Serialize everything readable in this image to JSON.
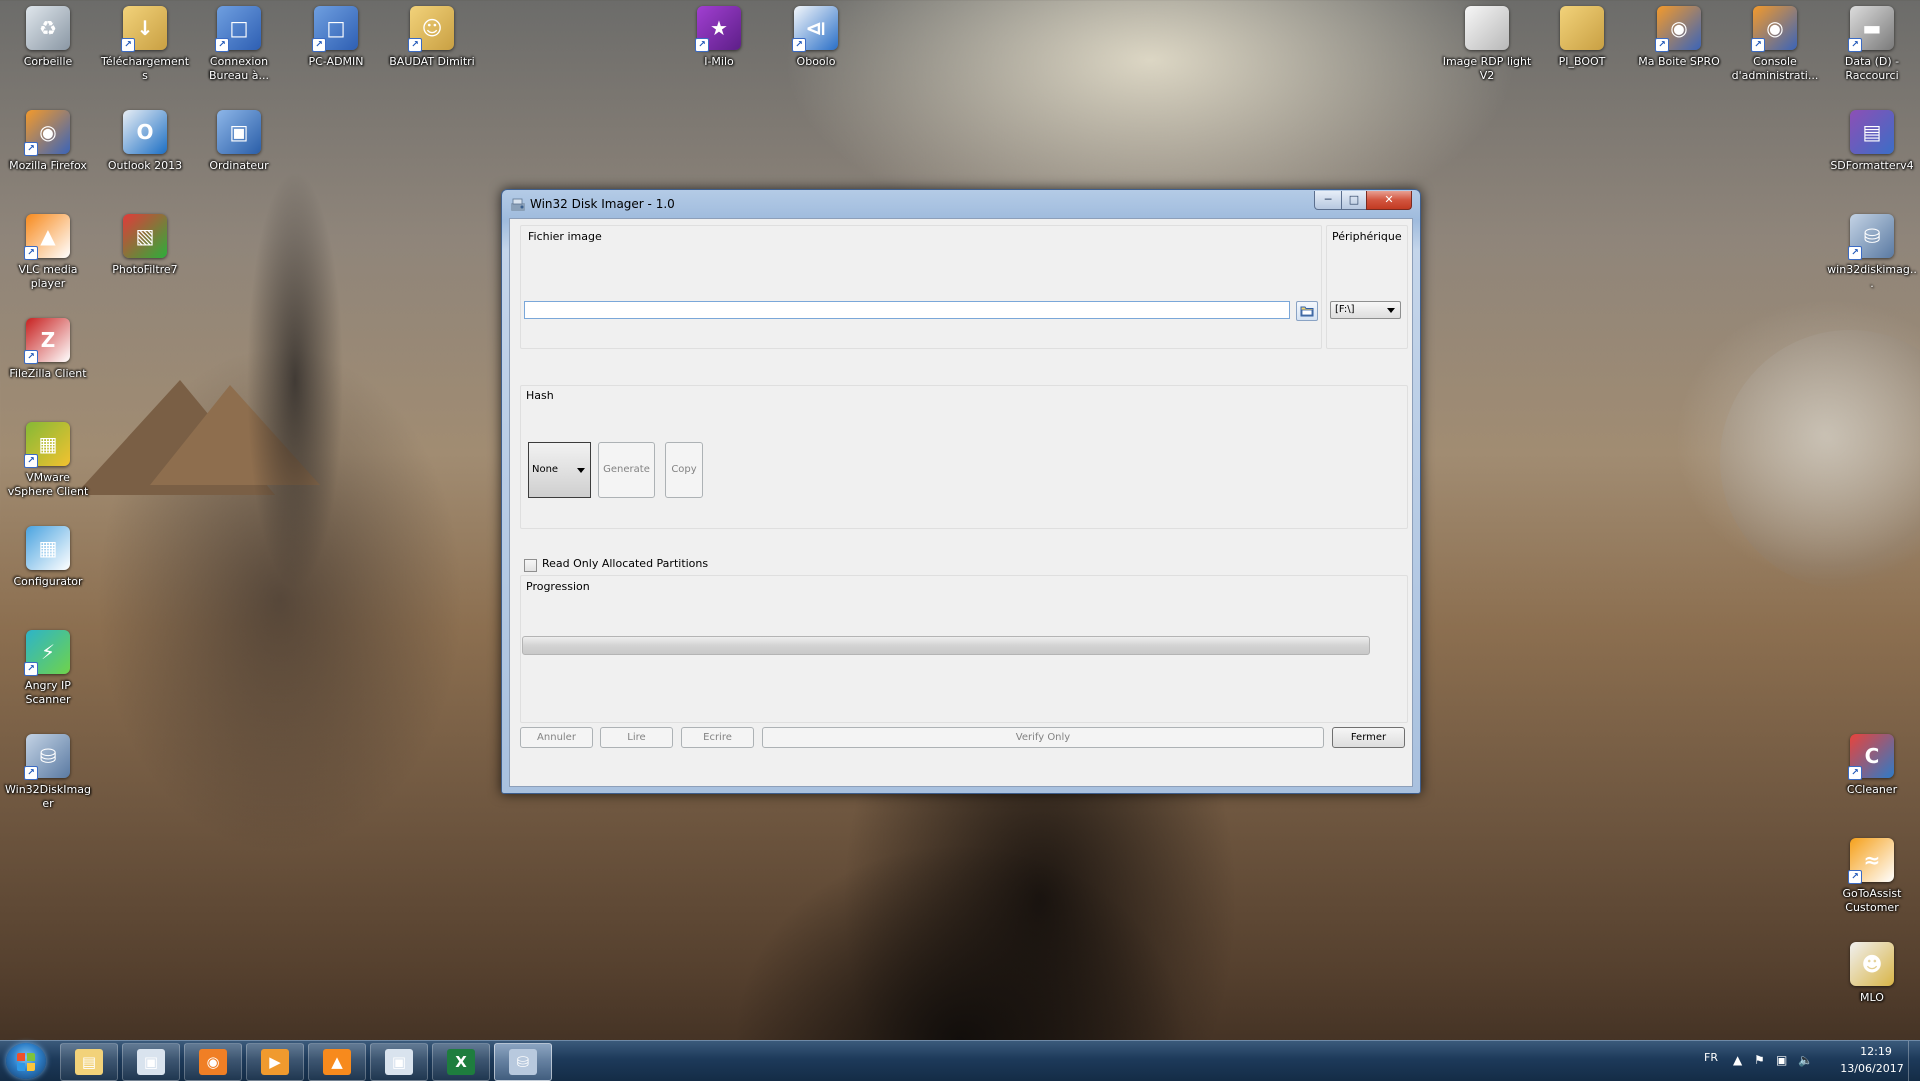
{
  "desktop": {
    "icons_left": [
      {
        "label": "Corbeille",
        "icon": "recycle-bin-icon"
      },
      {
        "label": "Téléchargements",
        "icon": "downloads-folder-icon"
      },
      {
        "label": "Connexion Bureau à...",
        "icon": "remote-desktop-icon"
      },
      {
        "label": "PC-ADMIN",
        "icon": "remote-desktop-icon"
      },
      {
        "label": "BAUDAT Dimitri",
        "icon": "user-folder-icon"
      },
      {
        "label": "Mozilla Firefox",
        "icon": "firefox-icon"
      },
      {
        "label": "Outlook 2013",
        "icon": "outlook-icon"
      },
      {
        "label": "Ordinateur",
        "icon": "computer-icon"
      },
      {
        "label": "VLC media player",
        "icon": "vlc-icon"
      },
      {
        "label": "PhotoFiltre7",
        "icon": "photofiltre-icon"
      },
      {
        "label": "FileZilla Client",
        "icon": "filezilla-icon"
      },
      {
        "label": "VMware vSphere Client",
        "icon": "vsphere-icon"
      },
      {
        "label": "Configurator",
        "icon": "configurator-icon"
      },
      {
        "label": "Angry IP Scanner",
        "icon": "angry-ip-scanner-icon"
      },
      {
        "label": "Win32DiskImager",
        "icon": "win32diskimager-icon"
      }
    ],
    "icons_center": [
      {
        "label": "I-Milo",
        "icon": "mask-icon"
      },
      {
        "label": "Oboolo",
        "icon": "oboolo-icon"
      }
    ],
    "icons_right": [
      {
        "label": "Image RDP light V2",
        "icon": "file-icon"
      },
      {
        "label": "PI_BOOT",
        "icon": "folder-icon"
      },
      {
        "label": "Ma Boite SPRO",
        "icon": "firefox-icon"
      },
      {
        "label": "Console d'administrati...",
        "icon": "firefox-icon"
      },
      {
        "label": "Data (D) - Raccourci",
        "icon": "drive-icon"
      },
      {
        "label": "SDFormatterv4",
        "icon": "winrar-icon"
      },
      {
        "label": "win32diskimag...",
        "icon": "win32diskimager-icon"
      },
      {
        "label": "CCleaner",
        "icon": "ccleaner-icon"
      },
      {
        "label": "GoToAssist Customer",
        "icon": "gotoassist-icon"
      },
      {
        "label": "MLO",
        "icon": "mlo-icon"
      }
    ]
  },
  "window": {
    "title": "Win32 Disk Imager - 1.0",
    "image_group_title": "Fichier image",
    "image_path_value": "",
    "device_group_title": "Périphérique",
    "device_selected": "[F:\\]",
    "hash_group_title": "Hash",
    "hash_selected": "None",
    "generate_label": "Generate",
    "copy_label": "Copy",
    "readonly_label": "Read Only Allocated Partitions",
    "progress_group_title": "Progression",
    "progress_fraction": 0,
    "cancel_label": "Annuler",
    "read_label": "Lire",
    "write_label": "Ecrire",
    "verify_label": "Verify Only",
    "close_label": "Fermer"
  },
  "taskbar": {
    "apps": [
      "explorer-icon",
      "window-app-icon",
      "firefox-icon",
      "media-player-icon",
      "vlc-icon",
      "window-app-icon",
      "excel-icon",
      "win32diskimager-icon"
    ],
    "language": "FR",
    "time": "12:19",
    "date": "13/06/2017"
  },
  "colors": {
    "window_frame": "#a9c1df",
    "close_button": "#c23a22",
    "taskbar": "#1d3a5a"
  }
}
